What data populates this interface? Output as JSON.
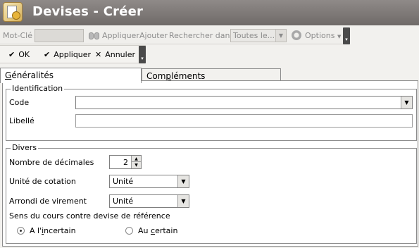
{
  "window": {
    "title": "Devises - Créer"
  },
  "search_toolbar": {
    "keyword_label": "Mot-Clé",
    "keyword_value": "",
    "apply_label": "Appliquer",
    "add_label": "Ajouter",
    "search_in_label": "Rechercher dans",
    "search_in_value": "Toutes le...",
    "options_label": "Options"
  },
  "action_toolbar": {
    "ok_label": "OK",
    "apply_label": "Appliquer",
    "cancel_label": "Annuler"
  },
  "tabs": [
    {
      "label_pre": "",
      "label_key": "G",
      "label_post": "énéralités",
      "active": true
    },
    {
      "label_pre": "Com",
      "label_key": "p",
      "label_post": "léments",
      "active": false
    }
  ],
  "identification": {
    "title": "Identification",
    "code_label": "Code",
    "code_value": "",
    "libelle_label": "Libellé",
    "libelle_value": ""
  },
  "divers": {
    "title": "Divers",
    "decimals_label": "Nombre de décimales",
    "decimals_value": "2",
    "cotation_label": "Unité de cotation",
    "cotation_value": "Unité",
    "arrondi_label": "Arrondi de virement",
    "arrondi_value": "Unité",
    "sens_label": "Sens du cours contre devise de référence",
    "radio_incertain_pre": "A l'",
    "radio_incertain_key": "i",
    "radio_incertain_post": "ncertain",
    "radio_certain_pre": "Au ",
    "radio_certain_key": "c",
    "radio_certain_post": "ertain",
    "selected": "incertain"
  }
}
